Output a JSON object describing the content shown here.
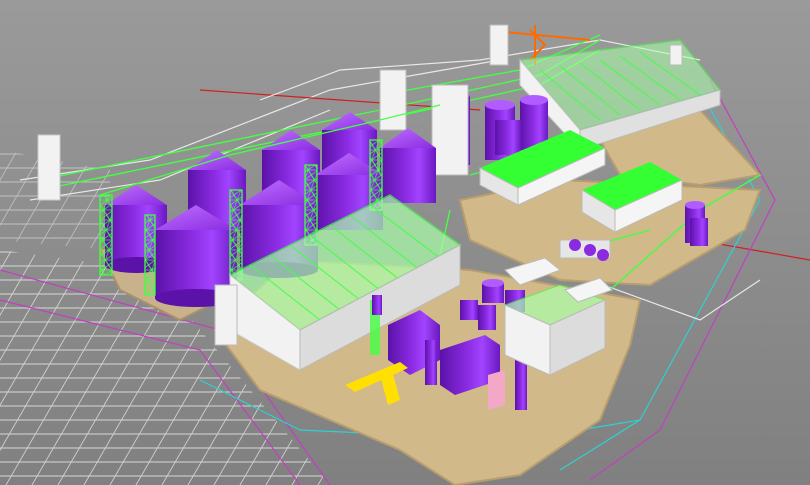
{
  "scene": {
    "kind": "3d-cad-render",
    "subject": "industrial-grain-terminal",
    "colors": {
      "ground": "#8c8c8c",
      "pad": "#d1b98a",
      "pad_edge": "#b89e6e",
      "silo": "#8a2be2",
      "silo_dark": "#5b12a8",
      "silo_light": "#b05cff",
      "steel": "#44ff44",
      "glass": "#aaffaa",
      "building": "#f2f2f2",
      "building_shade": "#c8c8c8",
      "roof_green": "#33ff33",
      "conveyor_yellow": "#ffe000",
      "duct_pink": "#f4a8c8",
      "cad_line_white": "#e8e8e8",
      "cad_line_magenta": "#c040c0",
      "cad_line_cyan": "#30d0d0",
      "cad_line_red": "#d02020",
      "crane": "#ff6a00"
    },
    "features": [
      "silo-array-large",
      "silo-array-small",
      "storage-shed-glass",
      "warehouse-long",
      "white-block-buildings",
      "process-equipment",
      "conveyor-galleries",
      "parking-grid-cad",
      "tower-crane"
    ]
  }
}
